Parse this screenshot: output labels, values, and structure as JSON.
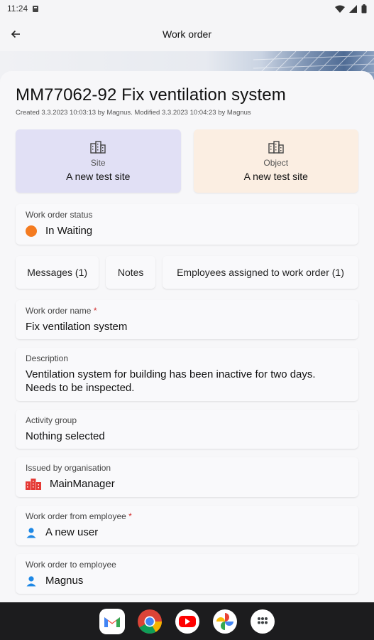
{
  "status_bar": {
    "time": "11:24"
  },
  "app_bar": {
    "title": "Work order"
  },
  "work_order": {
    "title": "MM77062-92 Fix ventilation system",
    "meta": "Created 3.3.2023 10:03:13 by Magnus. Modified 3.3.2023 10:04:23 by Magnus"
  },
  "tiles": {
    "site": {
      "label": "Site",
      "value": "A new test site"
    },
    "object": {
      "label": "Object",
      "value": "A new test site"
    }
  },
  "status": {
    "label": "Work order status",
    "value": "In Waiting",
    "color": "#f47b20"
  },
  "tabs": [
    {
      "label": "Messages (1)"
    },
    {
      "label": "Notes"
    },
    {
      "label": "Employees assigned to work order (1)"
    }
  ],
  "fields": {
    "name": {
      "label": "Work order name",
      "required_mark": "*",
      "value": "Fix ventilation system"
    },
    "description": {
      "label": "Description",
      "value": "Ventilation system for building has been inactive for two days. Needs to be inspected."
    },
    "activity_group": {
      "label": "Activity group",
      "value": "Nothing selected"
    },
    "issued_by": {
      "label": "Issued by organisation",
      "value": "MainManager",
      "icon": "building-icon"
    },
    "from_employee": {
      "label": "Work order from employee",
      "required_mark": "*",
      "value": "A new user",
      "icon": "person-icon"
    },
    "to_employee": {
      "label": "Work order to employee",
      "value": "Magnus",
      "icon": "person-icon"
    }
  },
  "dock": [
    "gmail-icon",
    "chrome-icon",
    "youtube-icon",
    "photos-icon",
    "app-drawer-icon"
  ],
  "colors": {
    "site_tile": "#e1e0f5",
    "object_tile": "#fbeee2",
    "required": "#d32f2f",
    "organisation_icon": "#e53935",
    "person_icon": "#1e88e5"
  }
}
